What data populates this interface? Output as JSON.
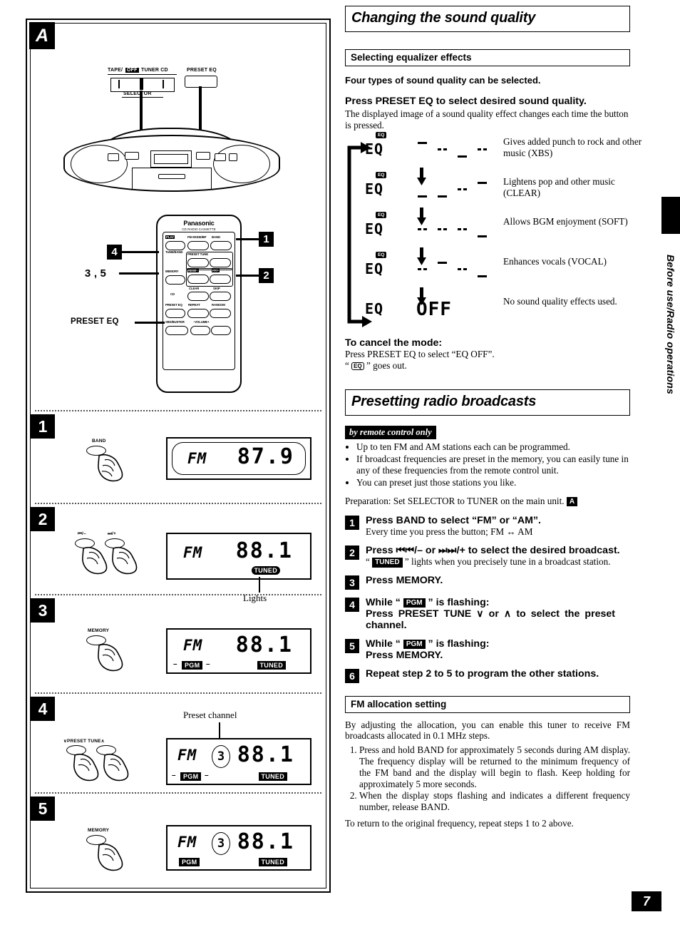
{
  "page": {
    "number": "7",
    "side_tab": "Before use/Radio operations"
  },
  "left_panel": {
    "figure_label": "A",
    "unit_labels": {
      "selector_left": "TAPE/",
      "selector_off": "OFF",
      "selector_right": "TUNER  CD",
      "selector_name": "SELECTOR",
      "preset_eq": "PRESET EQ"
    },
    "remote": {
      "brand": "Panasonic",
      "sub_brand": "CD RADIO CASSETTE",
      "keys": [
        {
          "label": "PLAY",
          "inverse": true
        },
        {
          "label": "TUNE/BAND"
        },
        {
          "label": "FM MODE/BP"
        },
        {
          "label": "BAND"
        },
        {
          "label": "PRESET TUNE"
        },
        {
          "label": "STOP"
        },
        {
          "label": "MEMORY"
        },
        {
          "label": "REW/–"
        },
        {
          "label": "FF/+"
        },
        {
          "label": "CLEAR"
        },
        {
          "label": "SKIP"
        },
        {
          "label": "CD"
        },
        {
          "label": "PRESET EQ"
        },
        {
          "label": "REPEAT"
        },
        {
          "label": "RANDOM"
        },
        {
          "label": "XBS/BUSTER"
        },
        {
          "label": "–VOLUME+"
        }
      ],
      "callouts": [
        {
          "text": "1"
        },
        {
          "text": "2"
        },
        {
          "text": "4"
        },
        {
          "text": "3 , 5"
        },
        {
          "text": "PRESET EQ"
        }
      ]
    },
    "steps": [
      {
        "num": "1",
        "button": "BAND",
        "display": {
          "band": "FM",
          "freq": "87.9",
          "tuned": false,
          "pgm": false,
          "preset": null
        },
        "caption": null
      },
      {
        "num": "2",
        "button": "◀◀/–   ▶▶/+",
        "button_left": "⏮/–",
        "button_right": "⏭/+",
        "display": {
          "band": "FM",
          "freq": "88.1",
          "tuned": true,
          "pgm": false,
          "preset": null
        },
        "caption": "Lights"
      },
      {
        "num": "3",
        "button": "MEMORY",
        "display": {
          "band": "FM",
          "freq": "88.1",
          "tuned": true,
          "pgm": true,
          "pgm_flashing": true,
          "preset": null
        },
        "caption": null
      },
      {
        "num": "4",
        "button": "PRESET TUNE",
        "button_left": "∨",
        "button_right": "∧",
        "display": {
          "band": "FM",
          "freq": "88.1",
          "tuned": true,
          "pgm": true,
          "pgm_flashing": true,
          "preset": "3"
        },
        "caption": "Preset channel"
      },
      {
        "num": "5",
        "button": "MEMORY",
        "display": {
          "band": "FM",
          "freq": "88.1",
          "tuned": true,
          "pgm": true,
          "pgm_flashing": false,
          "preset": "3"
        },
        "caption": null
      }
    ],
    "tags": {
      "tuned": "TUNED",
      "pgm": "PGM"
    }
  },
  "section1": {
    "title": "Changing the sound quality",
    "subtitle": "Selecting equalizer effects",
    "intro": "Four types of sound quality can be selected.",
    "instruction_bold": "Press PRESET EQ to select desired sound quality.",
    "instruction_body": "The displayed image of a sound quality effect changes each time the button is pressed.",
    "eq_cycle": {
      "lcd_text": "EQ",
      "eq_indicator": "EQ",
      "off_text": "OFF",
      "items": [
        {
          "desc": "Gives added punch to rock and other music (XBS)",
          "levels": [
            3,
            2,
            1,
            2
          ],
          "show_eq_badge": true
        },
        {
          "desc": "Lightens pop and other music (CLEAR)",
          "levels": [
            1,
            1,
            2,
            3
          ],
          "show_eq_badge": true
        },
        {
          "desc": "Allows BGM enjoyment (SOFT)",
          "levels": [
            2,
            2,
            2,
            1
          ],
          "show_eq_badge": true
        },
        {
          "desc": "Enhances vocals (VOCAL)",
          "levels": [
            2,
            3,
            2,
            1
          ],
          "show_eq_badge": true
        },
        {
          "desc": "No sound quality effects used.",
          "levels": [],
          "show_eq_badge": false,
          "is_off": true
        }
      ]
    },
    "cancel_heading": "To cancel the mode:",
    "cancel_line1": "Press PRESET EQ to select “EQ OFF”.",
    "cancel_line2_pre": "“ ",
    "cancel_line2_badge": "EQ",
    "cancel_line2_post": " ” goes out."
  },
  "section2": {
    "title": "Presetting radio broadcasts",
    "badge": "by remote control only",
    "bullets": [
      "Up to ten FM and AM stations each can be programmed.",
      "If broadcast frequencies are preset in the memory, you can easily tune in any of these frequencies from the remote control unit.",
      "You can preset just those stations you like."
    ],
    "preparation_pre": "Preparation: Set SELECTOR to TUNER on the main unit. ",
    "preparation_badge": "A",
    "steps": [
      {
        "num": "1",
        "bold": "Press BAND to select “FM” or “AM”.",
        "body": "Every time you press the button; FM ↔ AM"
      },
      {
        "num": "2",
        "bold": "Press ⏮⏮/– or ⏭⏭/+ to select the desired broadcast.",
        "body_pre": "“ ",
        "body_badge": "TUNED",
        "body_post": " ” lights when you precisely tune in a broadcast station."
      },
      {
        "num": "3",
        "bold": "Press MEMORY.",
        "body": ""
      },
      {
        "num": "4",
        "bold_pre": "While “ ",
        "bold_badge": "PGM",
        "bold_post": " ” is flashing:",
        "bold2": "Press PRESET TUNE ∨ or ∧ to select the preset channel.",
        "body": ""
      },
      {
        "num": "5",
        "bold_pre": "While “ ",
        "bold_badge": "PGM",
        "bold_post": " ” is flashing:",
        "bold2": "Press MEMORY.",
        "body": ""
      },
      {
        "num": "6",
        "bold": "Repeat step 2 to 5 to program the other stations.",
        "body": ""
      }
    ]
  },
  "section3": {
    "title": "FM allocation setting",
    "intro": "By adjusting the allocation, you can enable this tuner to receive FM broadcasts allocated in 0.1 MHz steps.",
    "steps": [
      "Press and hold BAND for approximately 5 seconds during AM display. The frequency display will be returned to the minimum frequency of the FM band and the display will begin to flash. Keep holding for approximately 5 more seconds.",
      "When the display stops flashing and indicates a different frequency number, release BAND."
    ],
    "footer": "To return to the original frequency, repeat steps 1 to 2 above."
  }
}
